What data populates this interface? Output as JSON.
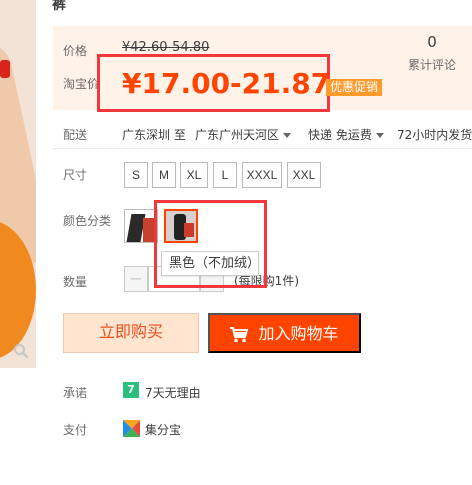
{
  "title_fragment": "裤",
  "price": {
    "label": "价格",
    "original": "¥42.60-54.80"
  },
  "sales": {
    "count": "0",
    "label": "累计评论"
  },
  "taobao_price": {
    "label": "淘宝价",
    "value": "¥17.00-21.87",
    "promo_badge": "优惠促销"
  },
  "shipping": {
    "label": "配送",
    "from": "广东深圳 至",
    "to": "广东广州天河区",
    "method": "快递 免运费",
    "delivery": "72小时内发货"
  },
  "size": {
    "label": "尺寸",
    "options": [
      "S",
      "M",
      "XL",
      "L",
      "XXXL",
      "XXL"
    ]
  },
  "color": {
    "label": "颜色分类",
    "tooltip": "黑色（不加绒）"
  },
  "quantity": {
    "label": "数量",
    "limit": "(每限购1件)"
  },
  "actions": {
    "buy_now": "立即购买",
    "add_cart": "加入购物车"
  },
  "promise": {
    "label": "承诺",
    "icon_text": "7",
    "text": "7天无理由"
  },
  "payment": {
    "label": "支付",
    "text": "集分宝"
  },
  "colors": {
    "accent": "#ff4400",
    "highlight": "#f2383c",
    "promo": "#ff9a2d"
  }
}
